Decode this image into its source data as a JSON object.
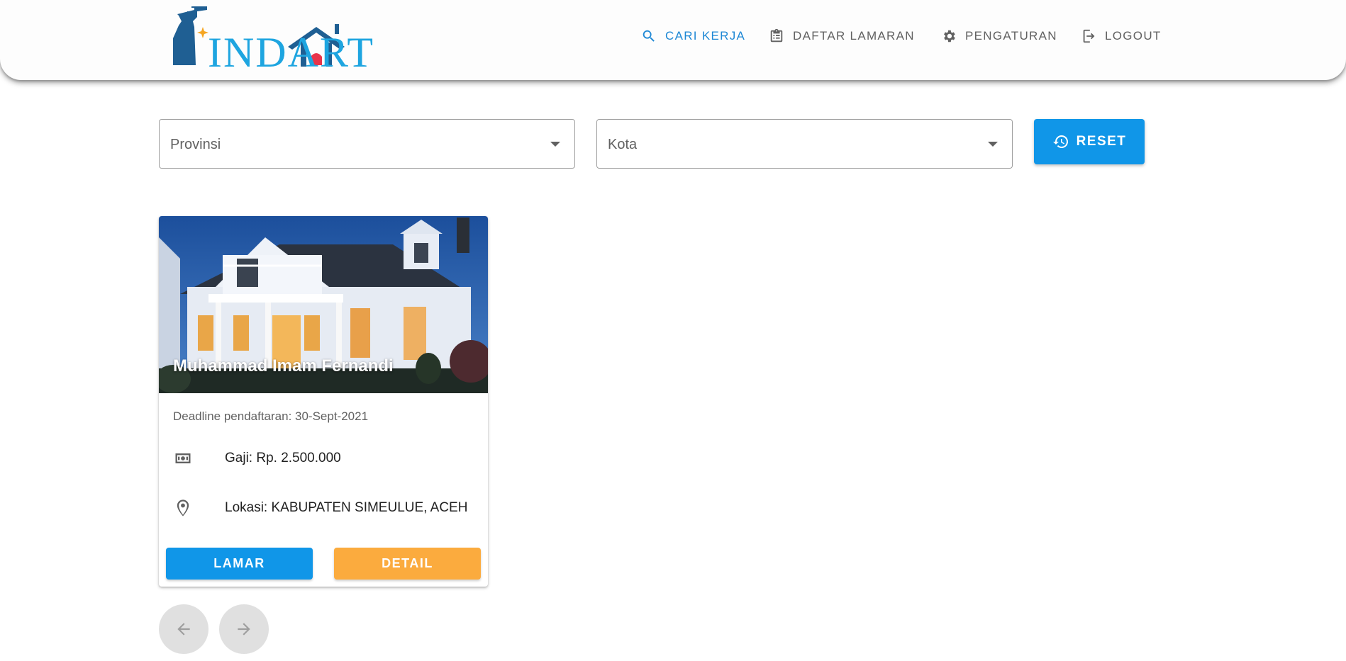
{
  "app": {
    "logo_text": "INDART"
  },
  "nav": {
    "cari_kerja": "CARI KERJA",
    "daftar_lamaran": "DAFTAR LAMARAN",
    "pengaturan": "PENGATURAN",
    "logout": "LOGOUT"
  },
  "filters": {
    "provinsi_placeholder": "Provinsi",
    "kota_placeholder": "Kota",
    "reset_label": "RESET"
  },
  "job_card": {
    "title": "Muhammad Imam Fernandi",
    "deadline": "Deadline pendaftaran: 30-Sept-2021",
    "salary": "Gaji: Rp. 2.500.000",
    "location": "Lokasi: KABUPATEN SIMEULUE, ACEH",
    "apply_label": "LAMAR",
    "detail_label": "DETAIL"
  },
  "pagination": {
    "prev_icon": "arrow-left-icon",
    "next_icon": "arrow-right-icon"
  },
  "colors": {
    "primary": "#1096e8",
    "accent": "#fbab3e",
    "nav_active": "#1e88d5"
  }
}
